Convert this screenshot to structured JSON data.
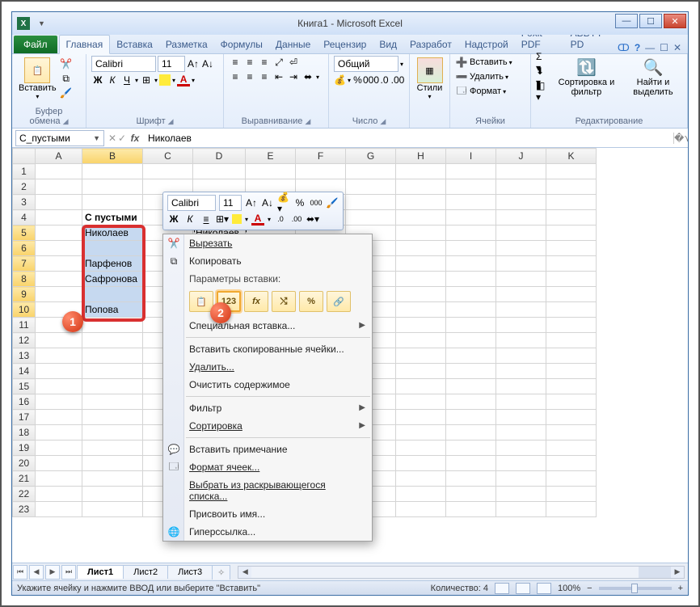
{
  "title": "Книга1 - Microsoft Excel",
  "tabs": {
    "file": "Файл",
    "items": [
      "Главная",
      "Вставка",
      "Разметка",
      "Формулы",
      "Данные",
      "Рецензир",
      "Вид",
      "Разработ",
      "Надстрой",
      "Foxit PDF",
      "ABBYY PD"
    ],
    "active": 0
  },
  "ribbon": {
    "clipboard": {
      "paste": "Вставить",
      "label": "Буфер обмена"
    },
    "font": {
      "name": "Calibri",
      "size": "11",
      "label": "Шрифт"
    },
    "align": {
      "label": "Выравнивание"
    },
    "number": {
      "format": "Общий",
      "label": "Число"
    },
    "styles": {
      "btn": "Стили"
    },
    "cells": {
      "insert": "Вставить",
      "delete": "Удалить",
      "format": "Формат",
      "label": "Ячейки"
    },
    "editing": {
      "sort": "Сортировка и фильтр",
      "find": "Найти и выделить",
      "label": "Редактирование"
    }
  },
  "fbar": {
    "name": "С_пустыми",
    "fx": "fx",
    "value": "Николаев"
  },
  "columns": [
    "A",
    "B",
    "C",
    "D",
    "E",
    "F",
    "G",
    "H",
    "I",
    "J",
    "K"
  ],
  "rows_header": 23,
  "cells": {
    "B4": "С пустыми",
    "B5": "Николаев",
    "B7": "Парфенов",
    "B8": "Сафронова",
    "B10": "Попова",
    "D5": "Николаев"
  },
  "minitb": {
    "font": "Calibri",
    "size": "11"
  },
  "ctx": {
    "cut": "Вырезать",
    "copy": "Копировать",
    "paste_params": "Параметры вставки:",
    "paste_special": "Специальная вставка...",
    "insert_copied": "Вставить скопированные ячейки...",
    "delete": "Удалить...",
    "clear": "Очистить содержимое",
    "filter": "Фильтр",
    "sort": "Сортировка",
    "comment": "Вставить примечание",
    "format": "Формат ячеек...",
    "dropdown": "Выбрать из раскрывающегося списка...",
    "name": "Присвоить имя...",
    "hyperlink": "Гиперссылка...",
    "pbtn2": "123"
  },
  "sheets": {
    "items": [
      "Лист1",
      "Лист2",
      "Лист3"
    ],
    "active": 0
  },
  "status": {
    "msg": "Укажите ячейку и нажмите ВВОД или выберите \"Вставить\"",
    "count_label": "Количество: 4",
    "zoom": "100%"
  },
  "callout1": "1",
  "callout2": "2"
}
